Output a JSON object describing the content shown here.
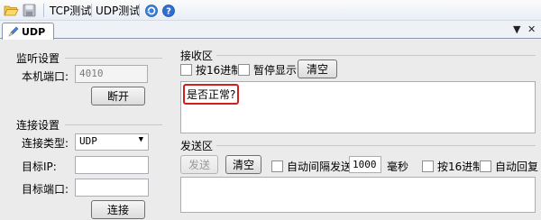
{
  "toolbar": {
    "tcp_label": "TCP测试",
    "udp_label": "UDP测试",
    "icons": [
      "open-folder-icon",
      "save-icon",
      "refresh-icon",
      "help-icon"
    ]
  },
  "tabs": [
    {
      "label": "UDP"
    }
  ],
  "tab_controls": {
    "dropdown": "▼",
    "close": "✕"
  },
  "listen": {
    "title": "监听设置",
    "port_label": "本机端口:",
    "port_value": "4010",
    "disconnect_label": "断开"
  },
  "connect": {
    "title": "连接设置",
    "type_label": "连接类型:",
    "type_value": "UDP",
    "target_ip_label": "目标IP:",
    "target_ip_value": "",
    "target_port_label": "目标端口:",
    "target_port_value": "",
    "connect_label": "连接"
  },
  "receive": {
    "title": "接收区",
    "hex_label": "按16进制",
    "pause_label": "暂停显示",
    "clear_label": "清空",
    "content": "是否正常?"
  },
  "send": {
    "title": "发送区",
    "send_label": "发送",
    "clear_label": "清空",
    "auto_interval_label": "自动间隔发送",
    "interval_value": "1000",
    "ms_label": "毫秒",
    "hex_label": "按16进制",
    "auto_reply_label": "自动回复"
  },
  "colors": {
    "highlight_border": "#d0201e",
    "toolbar_bg": "#e9eef6"
  }
}
